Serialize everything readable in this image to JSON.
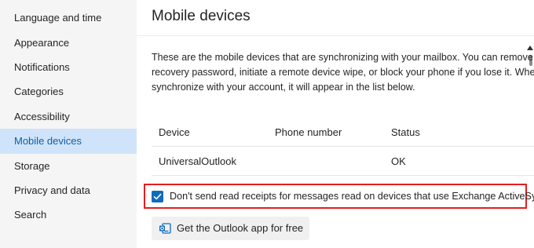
{
  "sidebar": {
    "items": [
      {
        "label": "Language and time"
      },
      {
        "label": "Appearance"
      },
      {
        "label": "Notifications"
      },
      {
        "label": "Categories"
      },
      {
        "label": "Accessibility"
      },
      {
        "label": "Mobile devices",
        "active": true
      },
      {
        "label": "Storage"
      },
      {
        "label": "Privacy and data"
      },
      {
        "label": "Search"
      }
    ]
  },
  "main": {
    "title": "Mobile devices",
    "description": [
      "These are the mobile devices that are synchronizing with your mailbox. You can remove a",
      "recovery password, initiate a remote device wipe, or block your phone if you lose it. Whe",
      "synchronize with your account, it will appear in the list below."
    ],
    "table": {
      "headers": [
        "Device",
        "Phone number",
        "Status"
      ],
      "rows": [
        {
          "device": "UniversalOutlook",
          "phone": "",
          "status": "OK"
        }
      ]
    },
    "read_receipts_checkbox": {
      "label": "Don't send read receipts for messages read on devices that use Exchange ActiveSync",
      "checked": true,
      "highlight_color": "#e41e1e"
    },
    "get_app_button": {
      "label": "Get the Outlook app for free",
      "icon": "outlook-app-icon"
    }
  },
  "colors": {
    "accent": "#0f6cbd",
    "active_nav_bg": "#cfe4fa",
    "active_nav_text": "#115ea3",
    "sidebar_bg": "#f5f5f5"
  }
}
